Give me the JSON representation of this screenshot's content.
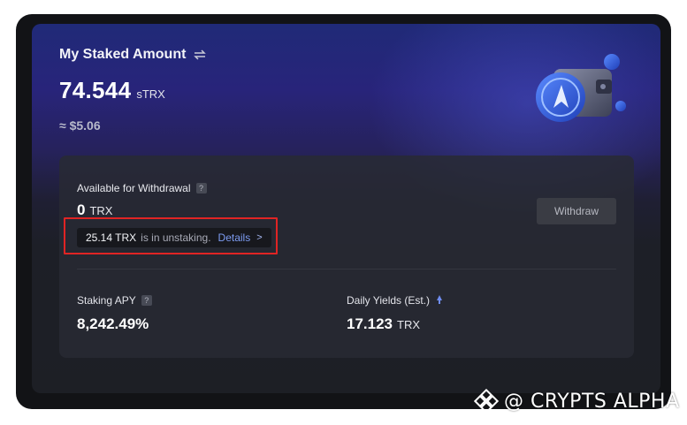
{
  "staked": {
    "title": "My Staked Amount",
    "amount": "74.544",
    "unit": "sTRX",
    "usd": "≈ $5.06"
  },
  "withdrawal": {
    "label": "Available for Withdrawal",
    "help": "?",
    "amount": "0",
    "unit": "TRX",
    "unstaking_amount": "25.14 TRX",
    "unstaking_text": "is in unstaking.",
    "details_label": "Details",
    "details_chevron": ">",
    "withdraw_button": "Withdraw"
  },
  "stats": {
    "apy_label": "Staking APY",
    "apy_help": "?",
    "apy_value": "8,242.49%",
    "yield_label": "Daily Yields (Est.)",
    "yield_value": "17.123",
    "yield_unit": "TRX"
  },
  "watermark": {
    "text": "@ CRYPTS ALPHA"
  },
  "icons": {
    "swap": "swap-arrows-icon",
    "rocket": "rocket-icon",
    "wallet": "wallet-illustration",
    "logo": "binance-logo"
  },
  "colors": {
    "accent_link": "#7d9cf2",
    "highlight_border": "#e02424",
    "card_gradient_top": "#202a78"
  }
}
